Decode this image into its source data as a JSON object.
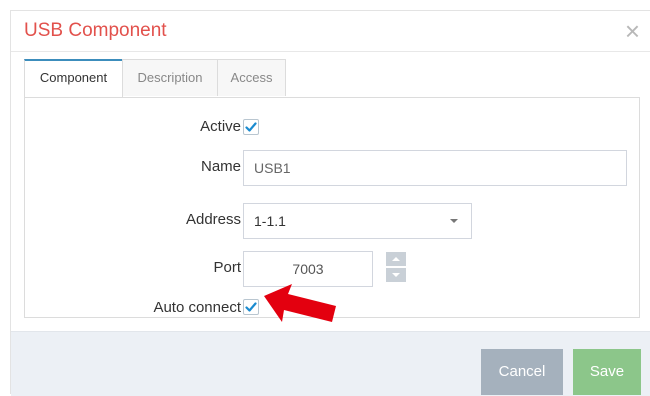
{
  "dialog": {
    "title": "USB Component",
    "close_symbol": "×"
  },
  "tabs": [
    {
      "label": "Component",
      "active": true
    },
    {
      "label": "Description",
      "active": false
    },
    {
      "label": "Access",
      "active": false
    }
  ],
  "form": {
    "active": {
      "label": "Active",
      "checked": true
    },
    "name": {
      "label": "Name",
      "value": "USB1"
    },
    "address": {
      "label": "Address",
      "value": "1-1.1"
    },
    "port": {
      "label": "Port",
      "value": "7003"
    },
    "auto_connect": {
      "label": "Auto connect",
      "checked": true
    }
  },
  "footer": {
    "cancel_label": "Cancel",
    "save_label": "Save"
  },
  "colors": {
    "title": "#e2514c",
    "checkmark": "#1a8bd0",
    "arrow": "#e3000f",
    "save_button": "#8cc68a",
    "cancel_button": "#a5b1bd"
  }
}
